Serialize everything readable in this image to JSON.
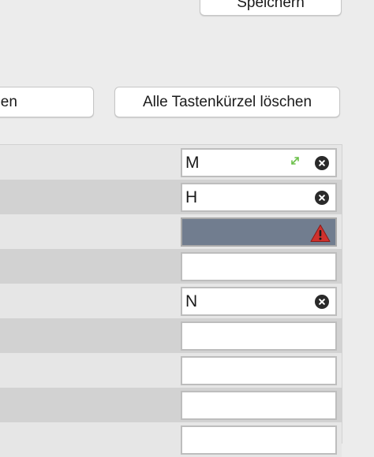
{
  "buttons": {
    "save_label": "Speichern",
    "reset_label": "tzen",
    "clear_all_label": "Alle Tastenkürzel löschen"
  },
  "rows": [
    {
      "shortcut": "M",
      "state": "filled",
      "has_resize_icon": true
    },
    {
      "shortcut": "H",
      "state": "filled"
    },
    {
      "shortcut": "",
      "state": "recording-conflict"
    },
    {
      "shortcut": "",
      "state": "empty"
    },
    {
      "shortcut": "N",
      "state": "filled"
    },
    {
      "shortcut": "",
      "state": "empty"
    },
    {
      "shortcut": "",
      "state": "empty"
    },
    {
      "shortcut": "",
      "state": "empty"
    },
    {
      "shortcut": "",
      "state": "empty"
    }
  ],
  "colors": {
    "window_bg": "#ececec",
    "row_odd": "#e6e6e6",
    "row_even": "#d2d2d2",
    "recording_field": "#717d8f",
    "warning": "#d0312d",
    "resize_icon": "#6cc04a"
  },
  "icons": {
    "clear": "clear-shortcut-icon",
    "warning": "warning-icon",
    "resize": "resize-arrow-icon"
  }
}
